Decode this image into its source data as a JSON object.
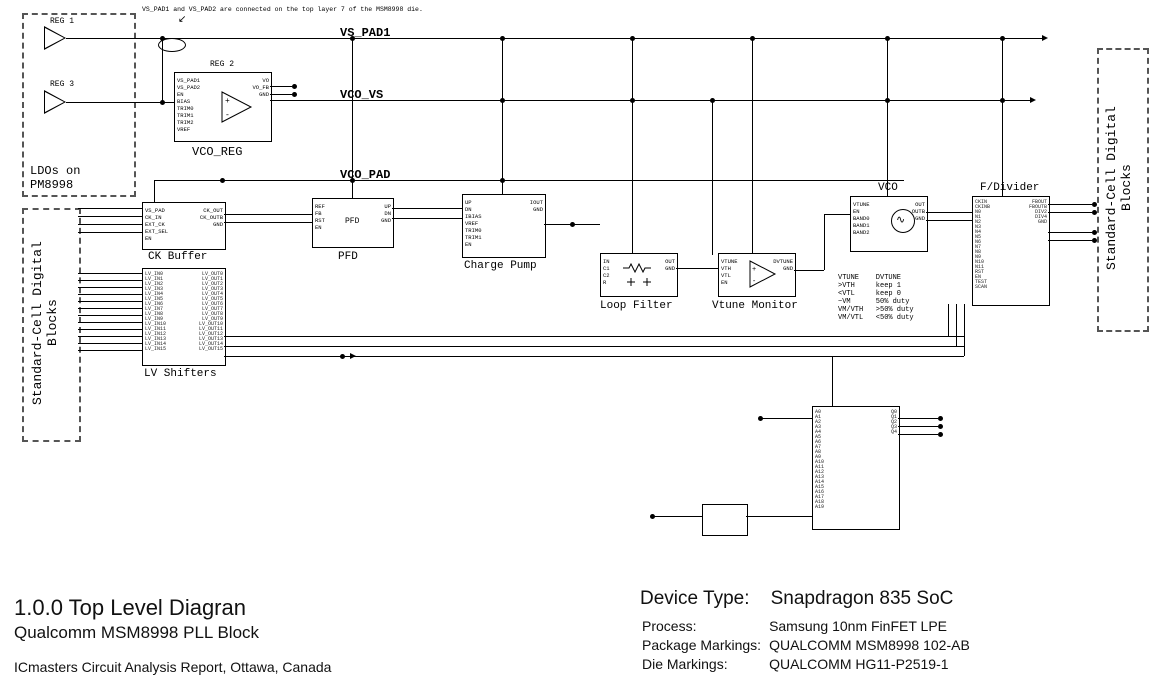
{
  "title_block": {
    "section_number": "1.0.0 Top Level Diagran",
    "subtitle": "Qualcomm MSM8998 PLL Block",
    "source": "ICmasters Circuit Analysis Report, Ottawa, Canada"
  },
  "device_info": {
    "device_type_label": "Device Type:",
    "device_type": "Snapdragon 835 SoC",
    "process_label": "Process:",
    "process": "Samsung 10nm FinFET LPE",
    "package_label": "Package Markings:",
    "package": "QUALCOMM MSM8998 102-AB",
    "die_label": "Die Markings:",
    "die": "QUALCOMM HG11-P2519-1"
  },
  "nets": {
    "vs_pad1": "VS_PAD1",
    "vco_vs": "VCO_VS",
    "vco_pad": "VCO_PAD"
  },
  "side_labels": {
    "ldo_box": "LDOs on\nPM8998",
    "left_digital": "Standard-Cell\nDigital Blocks",
    "right_digital": "Standard-Cell\nDigital Blocks"
  },
  "annotations": {
    "top_note": "VS_PAD1 and VS_PAD2 are connected on the top layer 7 of the MSM8998 die.",
    "vtune_table": "VTUNE    DVTUNE\n>VTH     keep 1\n<VTL     keep 0\n~VM      50% duty\nVM/VTH   >50% duty\nVM/VTL   <50% duty"
  },
  "inputs": {
    "reg1": "REG 1",
    "reg3": "REG 3",
    "reg2": "REG 2"
  },
  "blocks": {
    "vco_reg": "VCO_REG",
    "ck_buffer": "CK Buffer",
    "lv_shifters": "LV Shifters",
    "pfd": "PFD",
    "charge_pump": "Charge Pump",
    "loop_filter": "Loop Filter",
    "vtune_mon": "Vtune Monitor",
    "vco": "VCO",
    "fdivider": "F/Divider"
  }
}
